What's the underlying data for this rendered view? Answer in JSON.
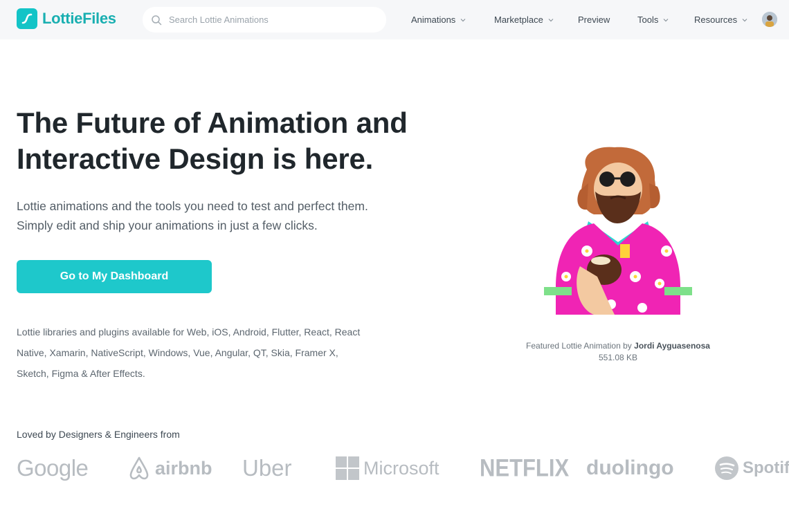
{
  "nav": {
    "logo_text_a": "Lottie",
    "logo_text_b": "Files",
    "search_placeholder": "Search Lottie Animations",
    "menu": [
      {
        "label": "Animations",
        "has_dropdown": true
      },
      {
        "label": "Marketplace",
        "has_dropdown": true
      },
      {
        "label": "Preview",
        "has_dropdown": false
      },
      {
        "label": "Tools",
        "has_dropdown": true
      },
      {
        "label": "Resources",
        "has_dropdown": true
      }
    ]
  },
  "hero": {
    "title_line1": "The Future of Animation and",
    "title_line2": "Interactive Design is here.",
    "subtitle_line1": "Lottie animations and the tools you need to test and perfect them.",
    "subtitle_line2": "Simply edit and ship your animations in just a few clicks.",
    "cta_label": "Go to My Dashboard",
    "libs_line1": "Lottie libraries and plugins available for Web, iOS, Android, Flutter, React, React",
    "libs_line2": "Native, Xamarin, NativeScript, Windows, Vue, Angular, QT, Skia, Framer X,",
    "libs_line3": "Sketch, Figma & After Effects."
  },
  "featured": {
    "credit_prefix": "Featured Lottie Animation by",
    "author": "Jordi Ayguasenosa",
    "size": "551.08 KB"
  },
  "loved": {
    "heading": "Loved by Designers & Engineers from",
    "brands": [
      "Google",
      "airbnb",
      "Uber",
      "Microsoft",
      "NETFLIX",
      "duolingo",
      "Spotify"
    ]
  },
  "colors": {
    "accent": "#1ec8cb",
    "nav_bg": "#f6f7f9",
    "heading": "#20272c",
    "logo_gray": "#b7bcc1"
  }
}
